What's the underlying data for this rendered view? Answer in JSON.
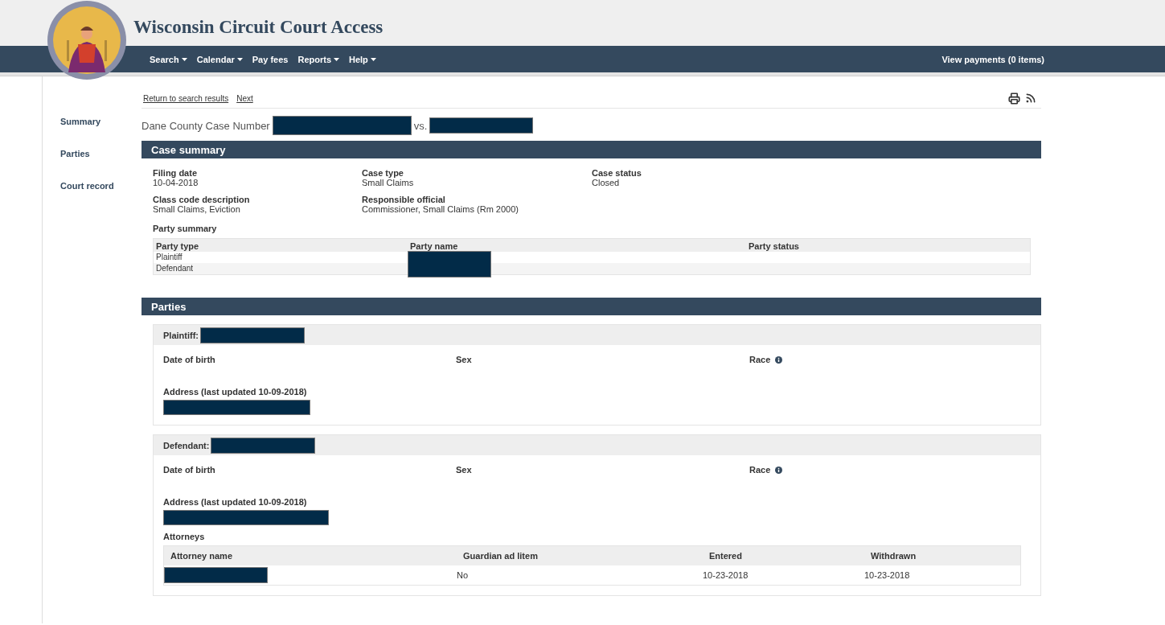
{
  "header": {
    "title": "Wisconsin Circuit Court Access",
    "nav": [
      {
        "label": "Search",
        "dropdown": true
      },
      {
        "label": "Calendar",
        "dropdown": true
      },
      {
        "label": "Pay fees",
        "dropdown": false
      },
      {
        "label": "Reports",
        "dropdown": true
      },
      {
        "label": "Help",
        "dropdown": true
      }
    ],
    "payments": "View payments (0 items)"
  },
  "sidebar": {
    "items": [
      {
        "label": "Summary"
      },
      {
        "label": "Parties"
      },
      {
        "label": "Court record"
      }
    ]
  },
  "links": [
    "Return to search results",
    "Next"
  ],
  "case_heading": {
    "prefix": "Dane County Case Number",
    "separator": "vs."
  },
  "case_summary": {
    "title": "Case summary",
    "fields": [
      {
        "label": "Filing date",
        "value": "10-04-2018"
      },
      {
        "label": "Case type",
        "value": "Small Claims"
      },
      {
        "label": "Case status",
        "value": "Closed"
      },
      {
        "label": "Class code description",
        "value": "Small Claims, Eviction"
      },
      {
        "label": "Responsible official",
        "value": "Commissioner, Small Claims (Rm 2000)"
      }
    ],
    "party_summary": {
      "title": "Party summary",
      "columns": [
        "Party type",
        "Party name",
        "Party status"
      ],
      "rows": [
        {
          "party_type": "Plaintiff"
        },
        {
          "party_type": "Defendant"
        }
      ]
    }
  },
  "parties": {
    "title": "Parties",
    "cards": [
      {
        "role": "Plaintiff:",
        "fields": [
          "Date of birth",
          "Sex",
          "Race"
        ],
        "address_label": "Address (last updated 10-09-2018)"
      },
      {
        "role": "Defendant:",
        "fields": [
          "Date of birth",
          "Sex",
          "Race"
        ],
        "address_label": "Address (last updated 10-09-2018)",
        "attorneys": {
          "title": "Attorneys",
          "columns": [
            "Attorney name",
            "Guardian ad litem",
            "Entered",
            "Withdrawn"
          ],
          "rows": [
            {
              "guardian_ad_litem": "No",
              "entered": "10-23-2018",
              "withdrawn": "10-23-2018"
            }
          ]
        }
      }
    ]
  }
}
